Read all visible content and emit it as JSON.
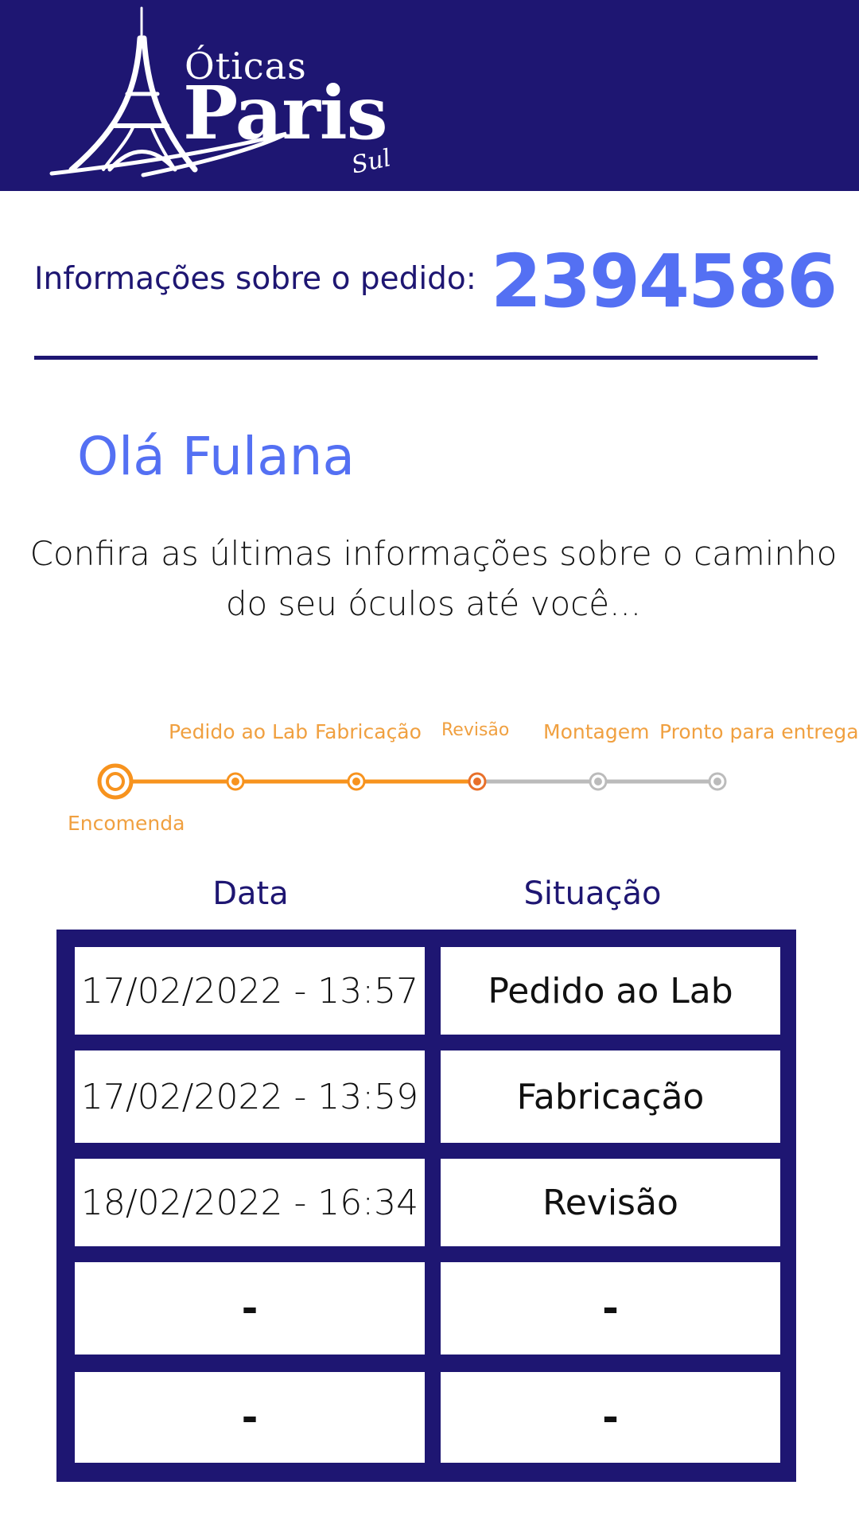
{
  "brand": {
    "line1": "Óticas",
    "line2": "Paris",
    "line3": "Sul",
    "logo_icon": "eiffel-tower-icon",
    "header_color": "#1e1672"
  },
  "order": {
    "label": "Informações sobre o pedido:",
    "number": "2394586"
  },
  "greeting": "Olá Fulana",
  "intro": "Confira as últimas informações sobre o caminho do seu óculos até você...",
  "tracker": {
    "completed_color": "#f7931e",
    "pending_color": "#bbbbbb",
    "current_step_index": 3,
    "steps": [
      {
        "label": "Encomenda",
        "status": "done"
      },
      {
        "label": "Pedido ao Lab",
        "status": "done"
      },
      {
        "label": "Fabricação",
        "status": "done"
      },
      {
        "label": "Revisão",
        "status": "current"
      },
      {
        "label": "Montagem",
        "status": "pending"
      },
      {
        "label": "Pronto para entrega",
        "status": "pending"
      }
    ]
  },
  "table": {
    "headers": [
      "Data",
      "Situação"
    ],
    "rows": [
      {
        "date": "17/02/2022 - 13:57",
        "status": "Pedido ao Lab"
      },
      {
        "date": "17/02/2022 - 13:59",
        "status": "Fabricação"
      },
      {
        "date": "18/02/2022 - 16:34",
        "status": "Revisão"
      },
      {
        "date": "-",
        "status": "-"
      },
      {
        "date": "-",
        "status": "-"
      }
    ]
  }
}
